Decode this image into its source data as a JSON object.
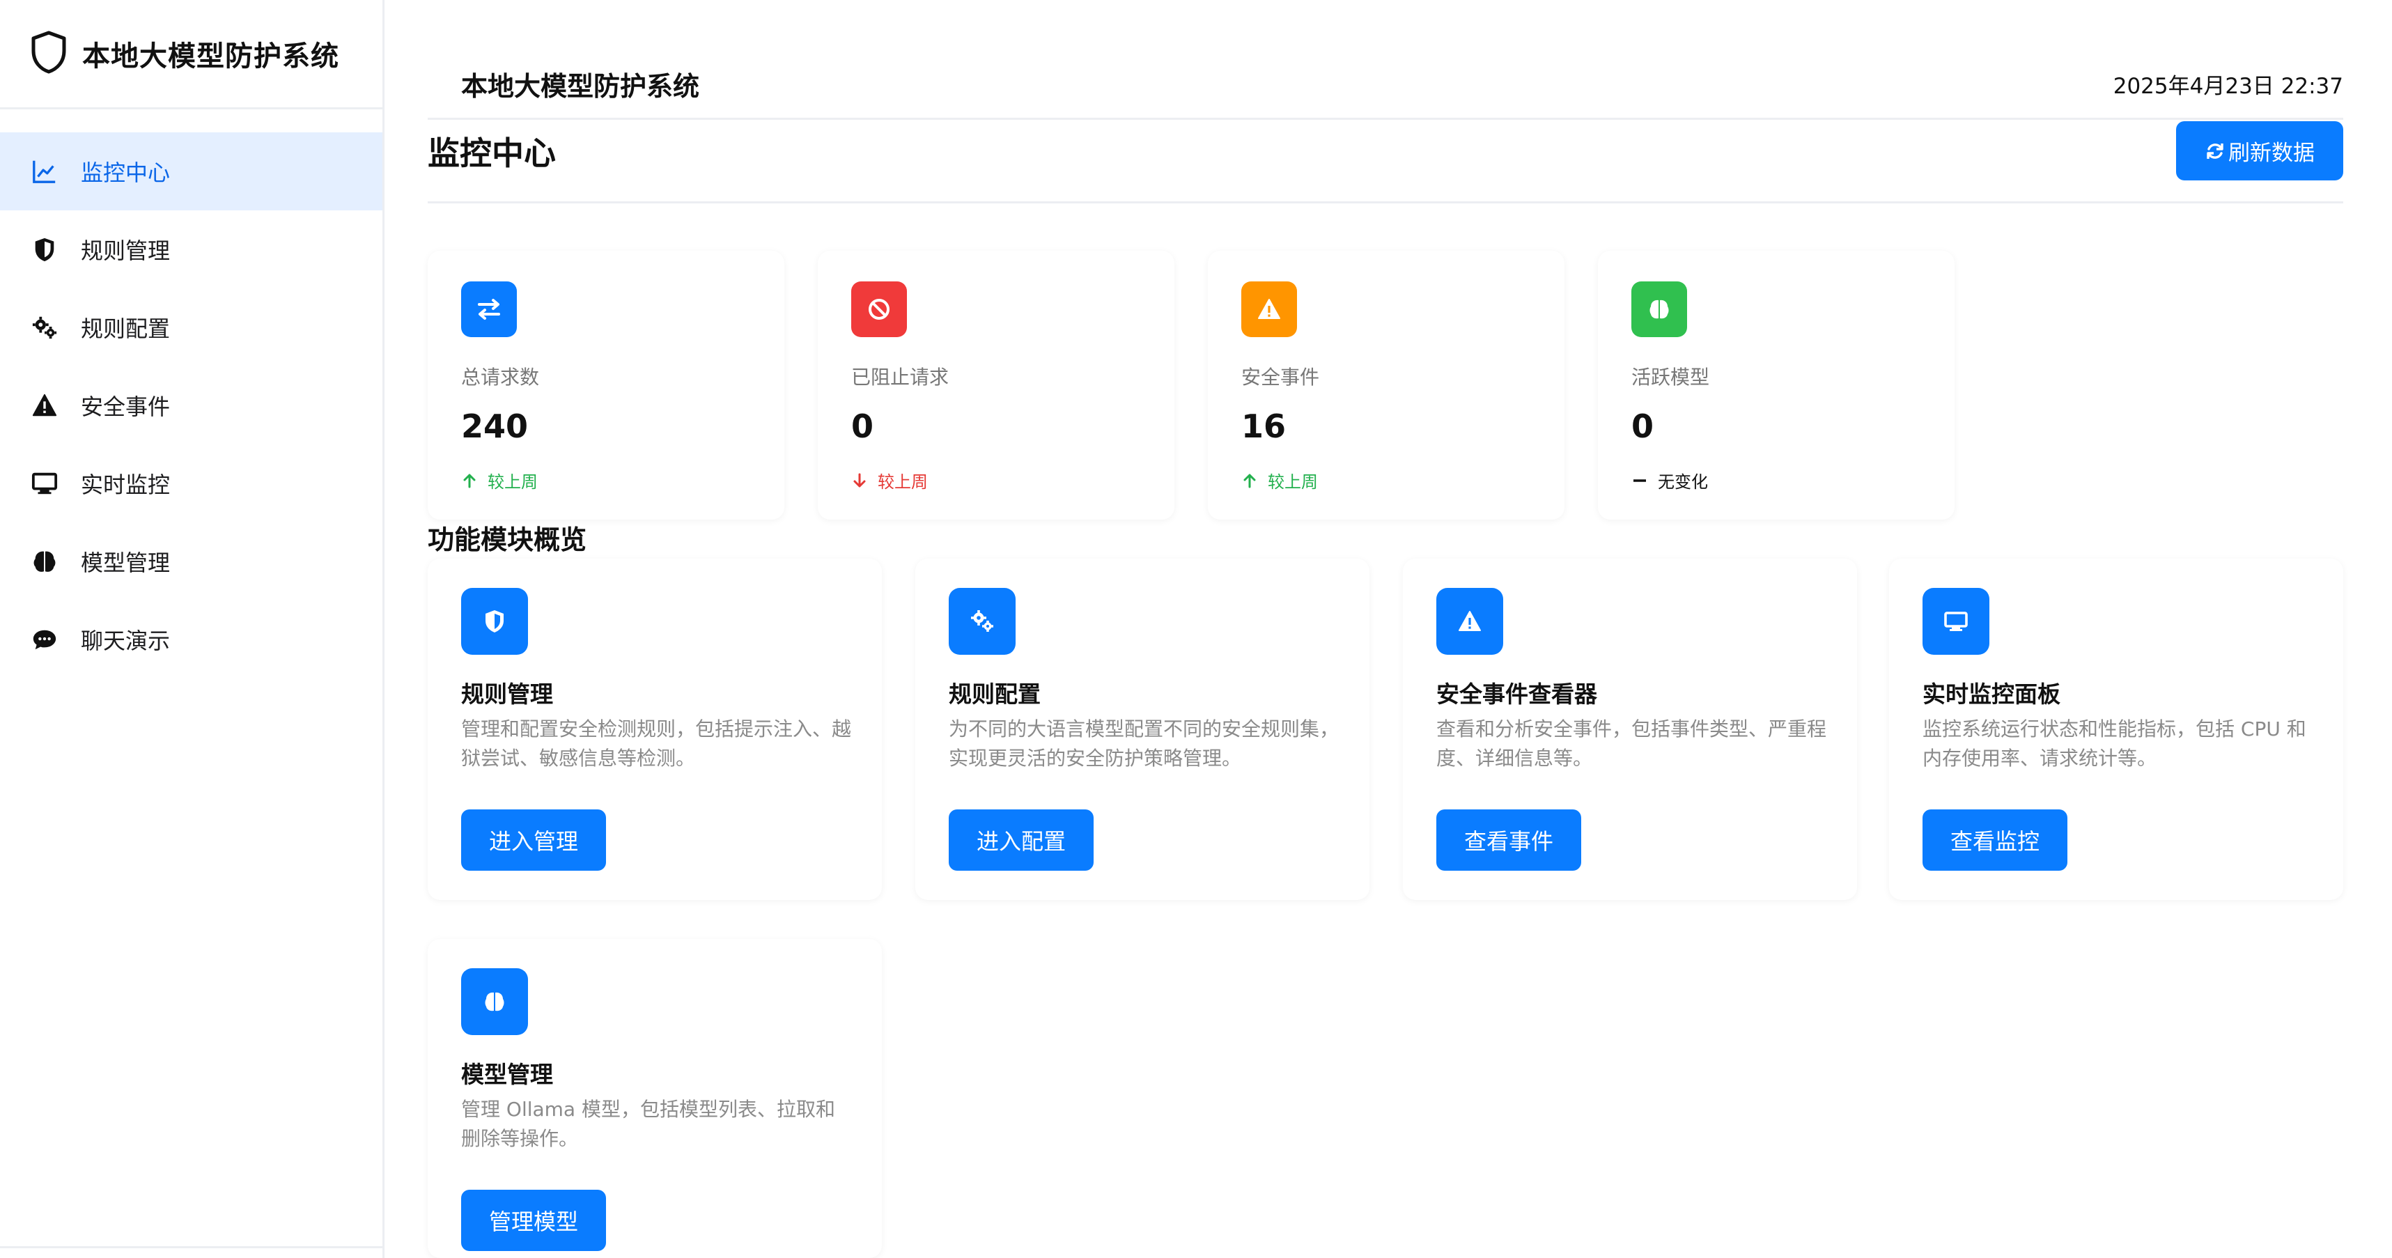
{
  "app": {
    "brand_title": "本地大模型防护系统"
  },
  "sidebar": {
    "items": [
      {
        "label": "监控中心",
        "icon": "chart-line-icon",
        "active": true
      },
      {
        "label": "规则管理",
        "icon": "shield-icon",
        "active": false
      },
      {
        "label": "规则配置",
        "icon": "gears-icon",
        "active": false
      },
      {
        "label": "安全事件",
        "icon": "warning-icon",
        "active": false
      },
      {
        "label": "实时监控",
        "icon": "monitor-icon",
        "active": false
      },
      {
        "label": "模型管理",
        "icon": "brain-icon",
        "active": false
      },
      {
        "label": "聊天演示",
        "icon": "chat-icon",
        "active": false
      }
    ]
  },
  "header": {
    "title": "本地大模型防护系统",
    "datetime": "2025年4月23日 22:37"
  },
  "page": {
    "title": "监控中心",
    "refresh_label": "刷新数据"
  },
  "stats": [
    {
      "label": "总请求数",
      "value": "240",
      "trend_text": "较上周",
      "trend": "up",
      "icon": "exchange-icon",
      "color": "#0a7cff"
    },
    {
      "label": "已阻止请求",
      "value": "0",
      "trend_text": "较上周",
      "trend": "down",
      "icon": "ban-icon",
      "color": "#f03a3a"
    },
    {
      "label": "安全事件",
      "value": "16",
      "trend_text": "较上周",
      "trend": "up",
      "icon": "warning-icon",
      "color": "#ff9500"
    },
    {
      "label": "活跃模型",
      "value": "0",
      "trend_text": "无变化",
      "trend": "flat",
      "icon": "brain-icon",
      "color": "#30c04f"
    }
  ],
  "modules": {
    "section_title": "功能模块概览",
    "items": [
      {
        "title": "规则管理",
        "desc": "管理和配置安全检测规则，包括提示注入、越狱尝试、敏感信息等检测。",
        "button": "进入管理",
        "icon": "shield-icon"
      },
      {
        "title": "规则配置",
        "desc": "为不同的大语言模型配置不同的安全规则集，实现更灵活的安全防护策略管理。",
        "button": "进入配置",
        "icon": "gears-icon"
      },
      {
        "title": "安全事件查看器",
        "desc": "查看和分析安全事件，包括事件类型、严重程度、详细信息等。",
        "button": "查看事件",
        "icon": "warning-icon"
      },
      {
        "title": "实时监控面板",
        "desc": "监控系统运行状态和性能指标，包括 CPU 和内存使用率、请求统计等。",
        "button": "查看监控",
        "icon": "monitor-icon"
      },
      {
        "title": "模型管理",
        "desc": "管理 Ollama 模型，包括模型列表、拉取和删除等操作。",
        "button": "管理模型",
        "icon": "brain-icon"
      }
    ]
  },
  "colors": {
    "accent": "#0a7cff",
    "active_nav_bg": "#e4efff",
    "trend_up": "#22b04d",
    "trend_down": "#e53935"
  }
}
